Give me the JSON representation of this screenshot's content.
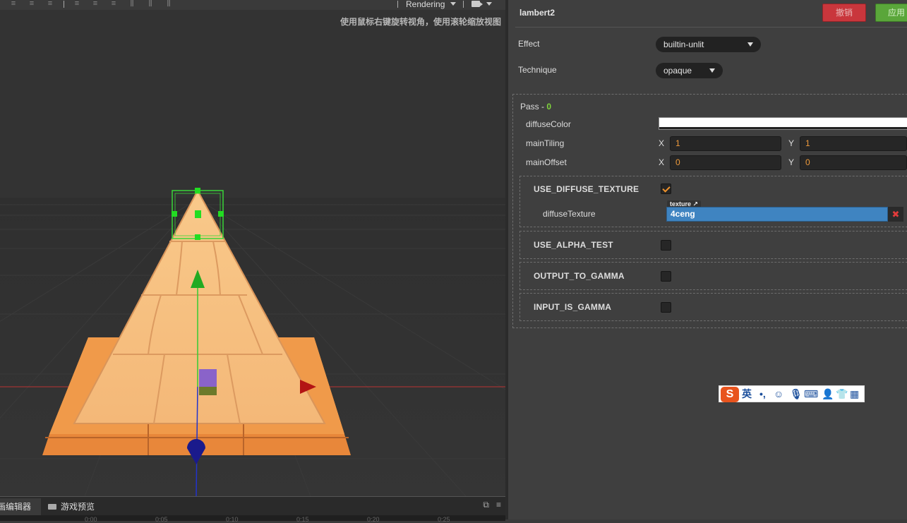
{
  "scene": {
    "rendering_label": "Rendering",
    "hint": "使用鼠标右键旋转视角，使用滚轮缩放视图"
  },
  "bottom": {
    "tab_animation": "画编辑器",
    "tab_game_preview": "游戏预览",
    "timeline_ticks": [
      "0:00",
      "0:05",
      "0:10",
      "0:15",
      "0:20",
      "0:25"
    ]
  },
  "inspector": {
    "material_name": "lambert2",
    "revert_label": "撤销",
    "apply_label": "应用",
    "effect_label": "Effect",
    "effect_value": "builtin-unlit",
    "technique_label": "Technique",
    "technique_value": "opaque",
    "pass_label": "Pass - ",
    "pass_index": "0",
    "diffuse_color_label": "diffuseColor",
    "diffuse_color_value": "#ffffff",
    "main_tiling_label": "mainTiling",
    "main_tiling": {
      "x_label": "X",
      "x": "1",
      "y_label": "Y",
      "y": "1"
    },
    "main_offset_label": "mainOffset",
    "main_offset": {
      "x_label": "X",
      "x": "0",
      "y_label": "Y",
      "y": "0"
    },
    "defines": [
      {
        "name": "USE_DIFFUSE_TEXTURE",
        "checked": true
      },
      {
        "name": "USE_ALPHA_TEST",
        "checked": false
      },
      {
        "name": "OUTPUT_TO_GAMMA",
        "checked": false
      },
      {
        "name": "INPUT_IS_GAMMA",
        "checked": false
      }
    ],
    "diffuse_texture_label": "diffuseTexture",
    "texture_tag": "texture",
    "texture_value": "4ceng",
    "texture_clear": "✖"
  },
  "ime": {
    "mode": "英",
    "punct": "•,"
  }
}
